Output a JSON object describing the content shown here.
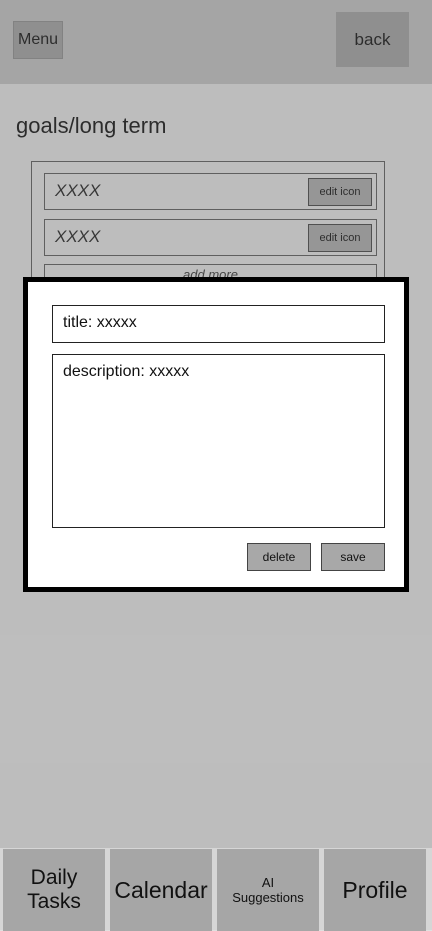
{
  "header": {
    "menu_label": "Menu",
    "back_label": "back"
  },
  "page": {
    "title": "goals/long term"
  },
  "goals": {
    "items": [
      {
        "text": "XXXX",
        "edit_label": "edit icon"
      },
      {
        "text": "XXXX",
        "edit_label": "edit icon"
      }
    ],
    "add_more_label": "add more"
  },
  "modal": {
    "title_value": "title: xxxxx",
    "description_value": "description: xxxxx",
    "delete_label": "delete",
    "save_label": "save"
  },
  "bottom_nav": {
    "daily_tasks": "Daily\nTasks",
    "calendar": "Calendar",
    "ai_suggestions": "AI\nSuggestions",
    "profile": "Profile"
  }
}
